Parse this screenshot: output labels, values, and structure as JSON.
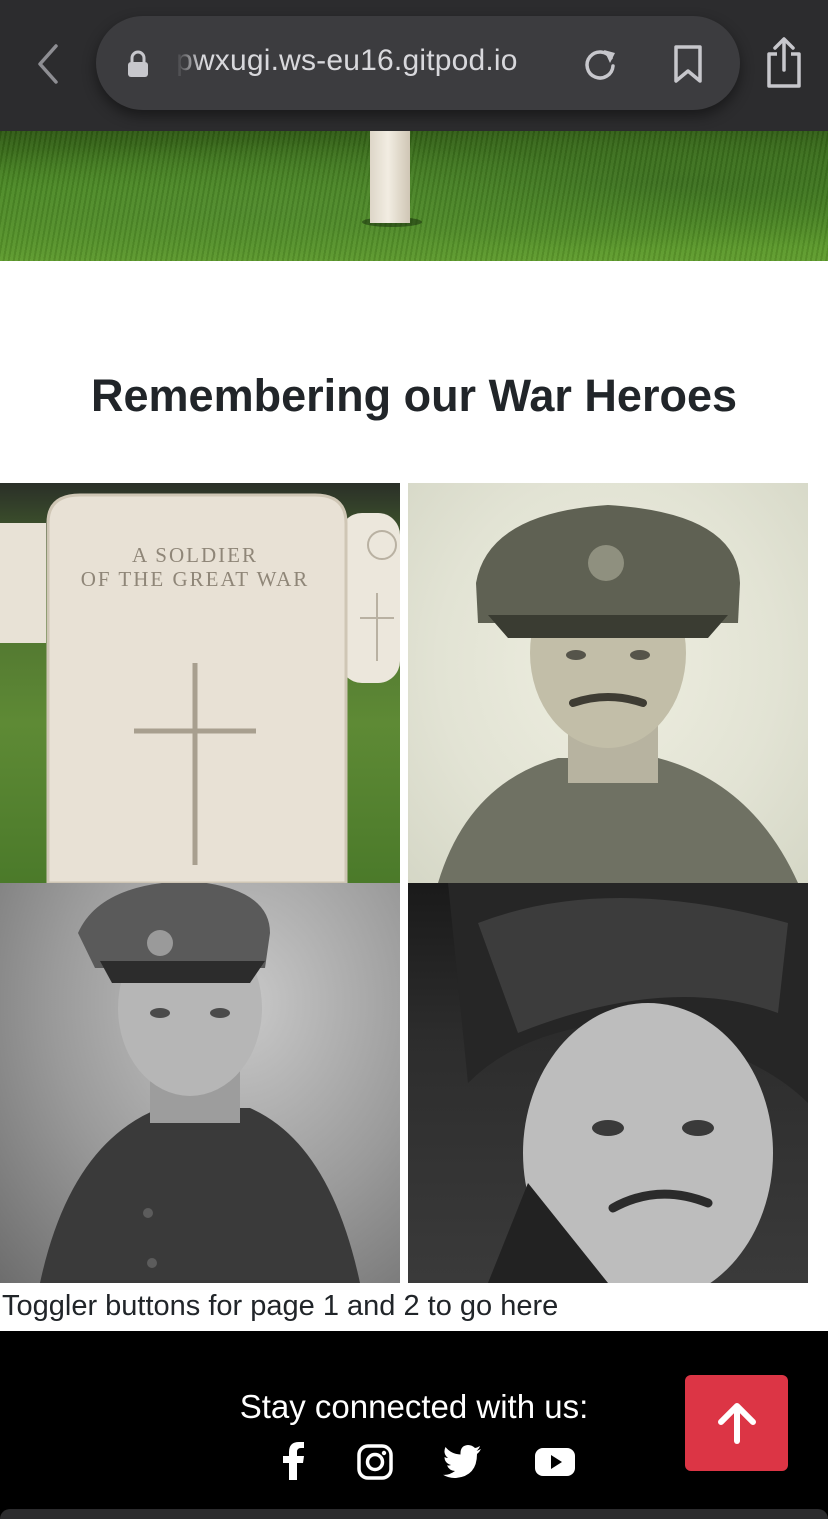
{
  "browser": {
    "url_text": "pwxugi.ws-eu16.gitpod.io",
    "icons": [
      "back-icon",
      "lock-icon",
      "reload-icon",
      "bookmark-icon",
      "share-icon"
    ]
  },
  "gallery": {
    "heading": "Remembering our War Heroes",
    "stone_inscription_line1": "A SOLDIER",
    "stone_inscription_line2": "OF THE GREAT WAR",
    "note": "Toggler buttons for page 1 and 2 to go here"
  },
  "footer": {
    "connect_text": "Stay connected with us:",
    "social_icons": [
      "facebook-icon",
      "instagram-icon",
      "twitter-icon",
      "youtube-icon"
    ],
    "scroll_top_icon": "arrow-up-icon",
    "accent_color": "#dc3545",
    "background_color": "#000000"
  }
}
